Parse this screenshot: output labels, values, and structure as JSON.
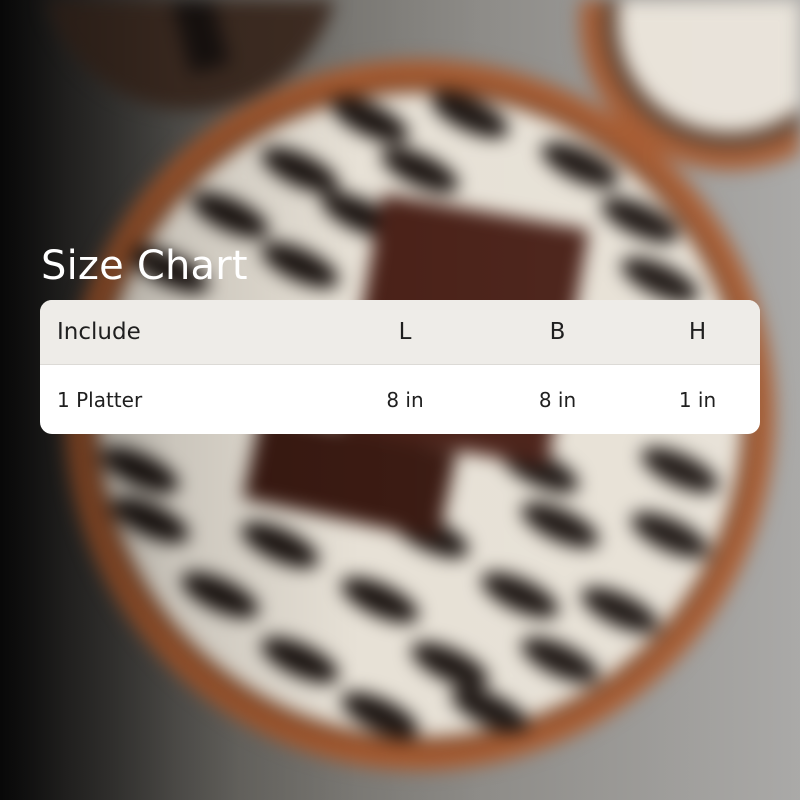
{
  "title": "Size Chart",
  "table": {
    "headers": [
      "Include",
      "L",
      "B",
      "H"
    ],
    "rows": [
      [
        "1 Platter",
        "8 in",
        "8 in",
        "1 in"
      ]
    ]
  },
  "colors": {
    "title": "#ffffff",
    "header_bg": "#eeece8",
    "row_bg": "#ffffff",
    "text": "#1f1f1f",
    "platter_rim": "#a2582f",
    "platter_face": "#e7e1d6",
    "pattern": "#1c1512",
    "napkin": "#4a2118"
  }
}
